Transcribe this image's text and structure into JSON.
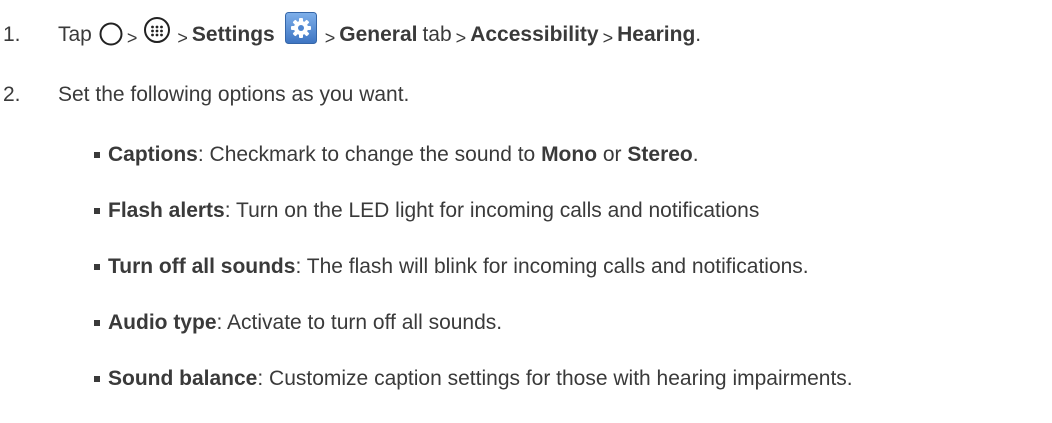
{
  "steps": [
    {
      "number": "1.",
      "tap": "Tap",
      "sep": ">",
      "settings": "Settings",
      "general": "General",
      "tab": "tab",
      "accessibility": "Accessibility",
      "hearing": "Hearing",
      "end": ".",
      "icons": [
        "home-circle-icon",
        "apps-icon",
        "settings-gear-icon"
      ]
    },
    {
      "number": "2.",
      "text": "Set the following options as you want."
    }
  ],
  "options": [
    {
      "term": "Captions",
      "colon": ":",
      "desc_a": " Checkmark to change the sound to ",
      "strong_a": "Mono",
      "desc_b": " or ",
      "strong_b": "Stereo",
      "desc_c": "."
    },
    {
      "term": "Flash alerts",
      "colon": ":",
      "desc": " Turn on the LED light for incoming calls and notifications"
    },
    {
      "term": "Turn off all sounds",
      "colon": ":",
      "desc": " The flash will blink for incoming calls and notifications."
    },
    {
      "term": "Audio type",
      "colon": ":",
      "desc": " Activate to turn off all sounds."
    },
    {
      "term": "Sound balance",
      "colon": ":",
      "desc": " Customize caption settings for those with hearing impairments."
    }
  ],
  "colors": {
    "text": "#3a3a3a",
    "gear_icon_bg": "#5b8fd0"
  }
}
